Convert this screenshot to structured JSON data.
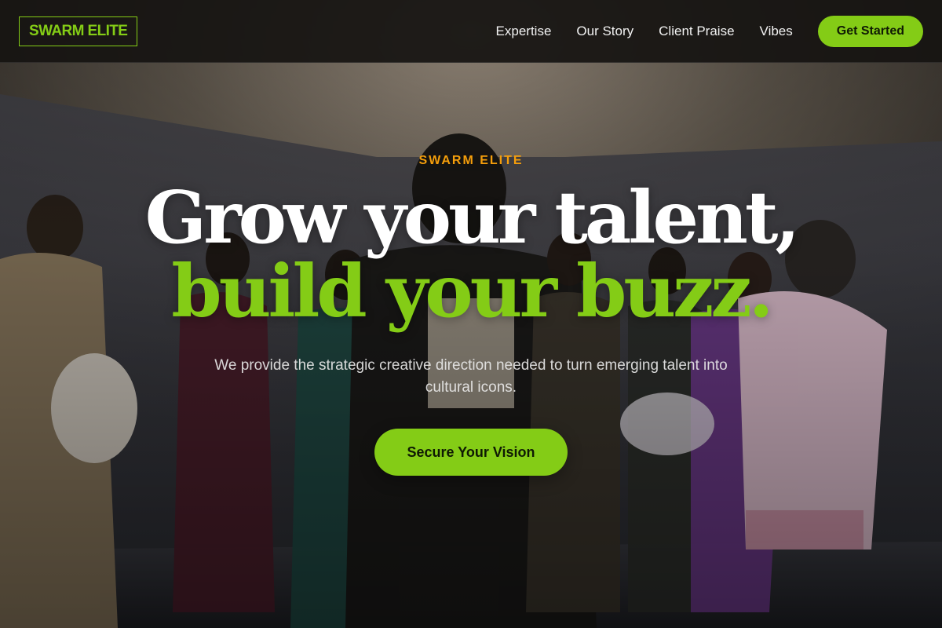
{
  "header": {
    "logo": "SWARM ELITE",
    "nav": [
      "Expertise",
      "Our Story",
      "Client Praise",
      "Vibes"
    ],
    "cta": "Get Started"
  },
  "hero": {
    "eyebrow": "SWARM ELITE",
    "headline_line1": "Grow your talent,",
    "headline_line2": "build your buzz.",
    "subtext": "We provide the strategic creative direction needed to turn emerging talent into cultural icons.",
    "cta": "Secure Your Vision"
  },
  "colors": {
    "accent": "#84cc16",
    "eyebrow": "#f59e0b",
    "header_bg": "#161411"
  }
}
